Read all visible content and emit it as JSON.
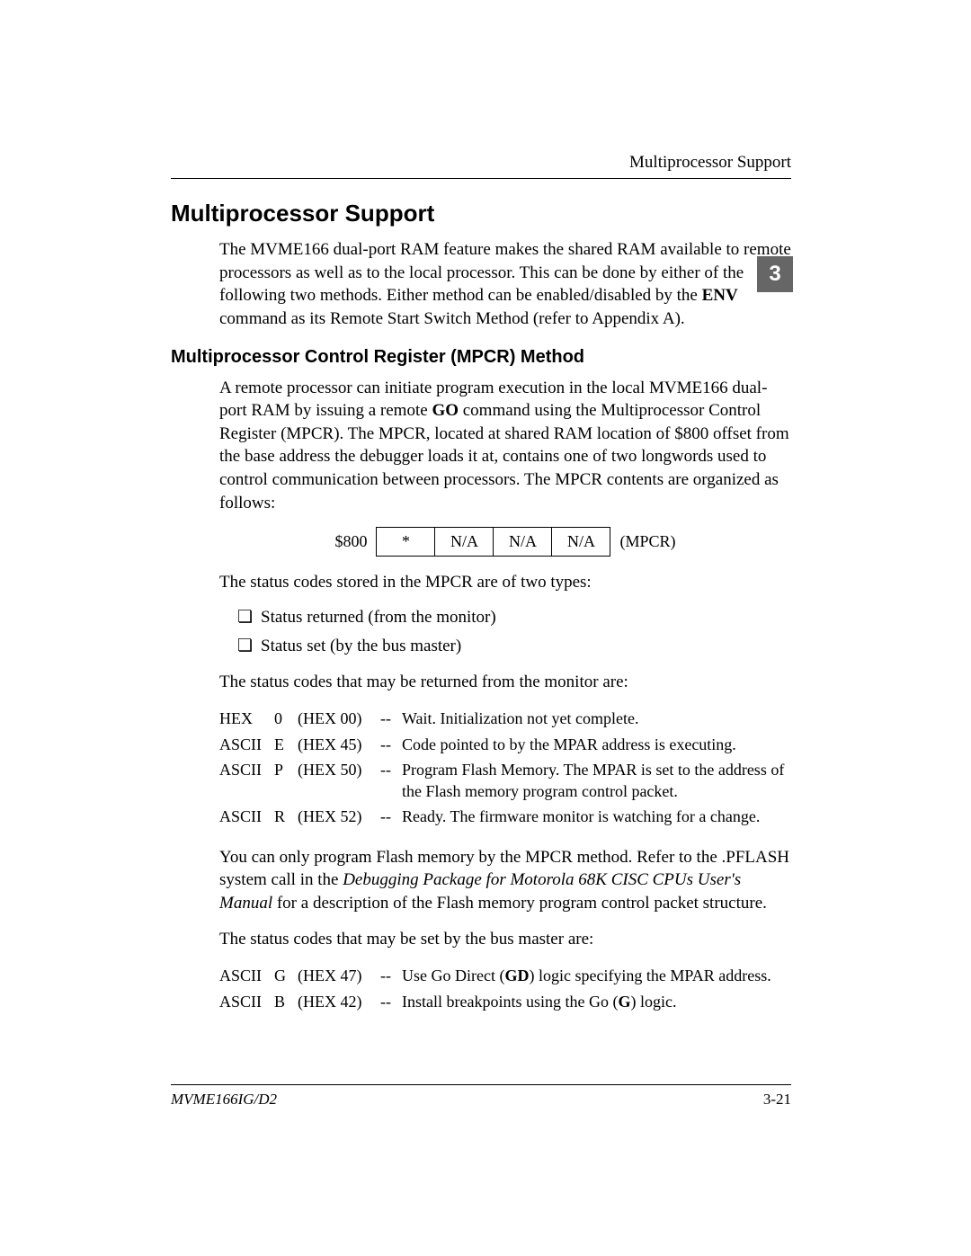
{
  "header": {
    "running": "Multiprocessor Support"
  },
  "chapter_tab": "3",
  "h1": "Multiprocessor Support",
  "intro": {
    "pre": "The MVME166 dual-port RAM feature makes the shared RAM available to remote processors as well as to the local processor.  This can be done by either of the following two methods.  Either method can be enabled/disabled by the ",
    "bold": "ENV",
    "post": " command as its Remote Start Switch Method (refer to Appendix A)."
  },
  "h2": "Multiprocessor Control Register (MPCR) Method",
  "mpcr_para": {
    "pre": "A remote processor can initiate program execution in the local MVME166 dual-port RAM by issuing a remote ",
    "bold": "GO",
    "post": " command using the Multiprocessor Control Register (MPCR).  The MPCR, located at shared RAM location of $800 offset from the base address the debugger loads it at, contains one of two longwords used to control communication between processors.  The MPCR contents are organized as follows:"
  },
  "mpcr_row": {
    "addr": "$800",
    "c1": "*",
    "c2": "N/A",
    "c3": "N/A",
    "c4": "N/A",
    "label": "(MPCR)"
  },
  "status_intro": "The status codes stored in the MPCR are of two types:",
  "bullets": [
    "Status returned (from the monitor)",
    "Status set (by the bus master)"
  ],
  "returned_intro": "The status codes that may be returned from the monitor are:",
  "returned_codes": [
    {
      "enc": "HEX",
      "ch": "0",
      "hex": "(HEX 00)",
      "dash": "--",
      "desc": "Wait.  Initialization not yet complete."
    },
    {
      "enc": "ASCII",
      "ch": "E",
      "hex": "(HEX 45)",
      "dash": "--",
      "desc": "Code pointed to by the MPAR address is executing."
    },
    {
      "enc": "ASCII",
      "ch": "P",
      "hex": "(HEX 50)",
      "dash": "--",
      "desc": "Program Flash Memory. The MPAR is set to the address of the Flash memory program control packet."
    },
    {
      "enc": "ASCII",
      "ch": "R",
      "hex": "(HEX 52)",
      "dash": "--",
      "desc": "Ready.  The firmware monitor is watching for a change."
    }
  ],
  "flash_para": {
    "pre": "You can only program Flash memory by the MPCR method.  Refer to the .PFLASH system call in the ",
    "ital": "Debugging Package for Motorola 68K CISC CPUs User's Manual",
    "post": " for a description of the Flash memory program control packet structure."
  },
  "set_intro": "The status codes that may be set by the bus master are:",
  "set_codes": [
    {
      "enc": "ASCII",
      "ch": "G",
      "hex": "(HEX 47)",
      "dash": "--",
      "desc_pre": "Use Go Direct (",
      "desc_bold": "GD",
      "desc_post": ") logic specifying the MPAR address."
    },
    {
      "enc": "ASCII",
      "ch": "B",
      "hex": "(HEX 42)",
      "dash": "--",
      "desc_pre": "Install breakpoints using the Go (",
      "desc_bold": "G",
      "desc_post": ") logic."
    }
  ],
  "footer": {
    "left": "MVME166IG/D2",
    "right": "3-21"
  }
}
